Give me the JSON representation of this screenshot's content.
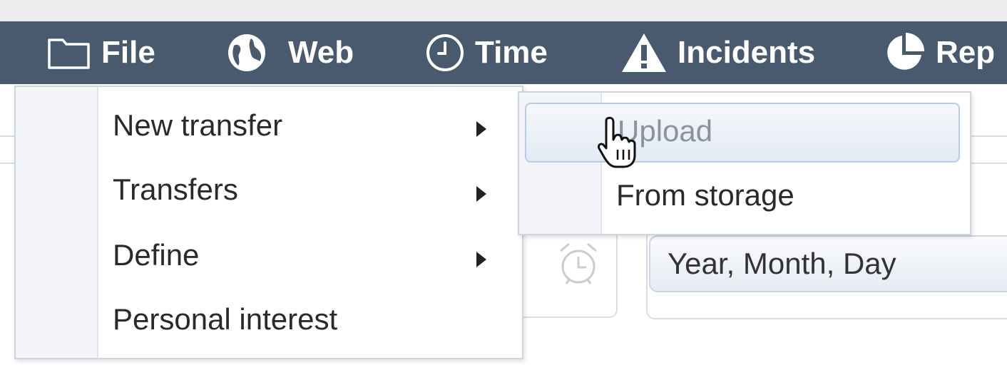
{
  "menubar": {
    "items": [
      {
        "label": "File",
        "icon": "folder-icon"
      },
      {
        "label": "Web",
        "icon": "globe-icon"
      },
      {
        "label": "Time",
        "icon": "clock-icon"
      },
      {
        "label": "Incidents",
        "icon": "warning-icon"
      },
      {
        "label": "Rep",
        "icon": "pie-chart-icon"
      }
    ]
  },
  "file_menu": {
    "items": [
      {
        "label": "New transfer",
        "submenu": true
      },
      {
        "label": "Transfers",
        "submenu": true
      },
      {
        "label": "Define",
        "submenu": true
      },
      {
        "label": "Personal interest",
        "submenu": false
      }
    ]
  },
  "new_transfer_submenu": {
    "items": [
      {
        "label": "Upload",
        "hovered": true
      },
      {
        "label": "From storage",
        "hovered": false
      }
    ]
  },
  "background": {
    "date_format_value": "Year, Month, Day"
  },
  "colors": {
    "menubar": "#4a5a6e",
    "hover_highlight": "#e3eaf4"
  }
}
